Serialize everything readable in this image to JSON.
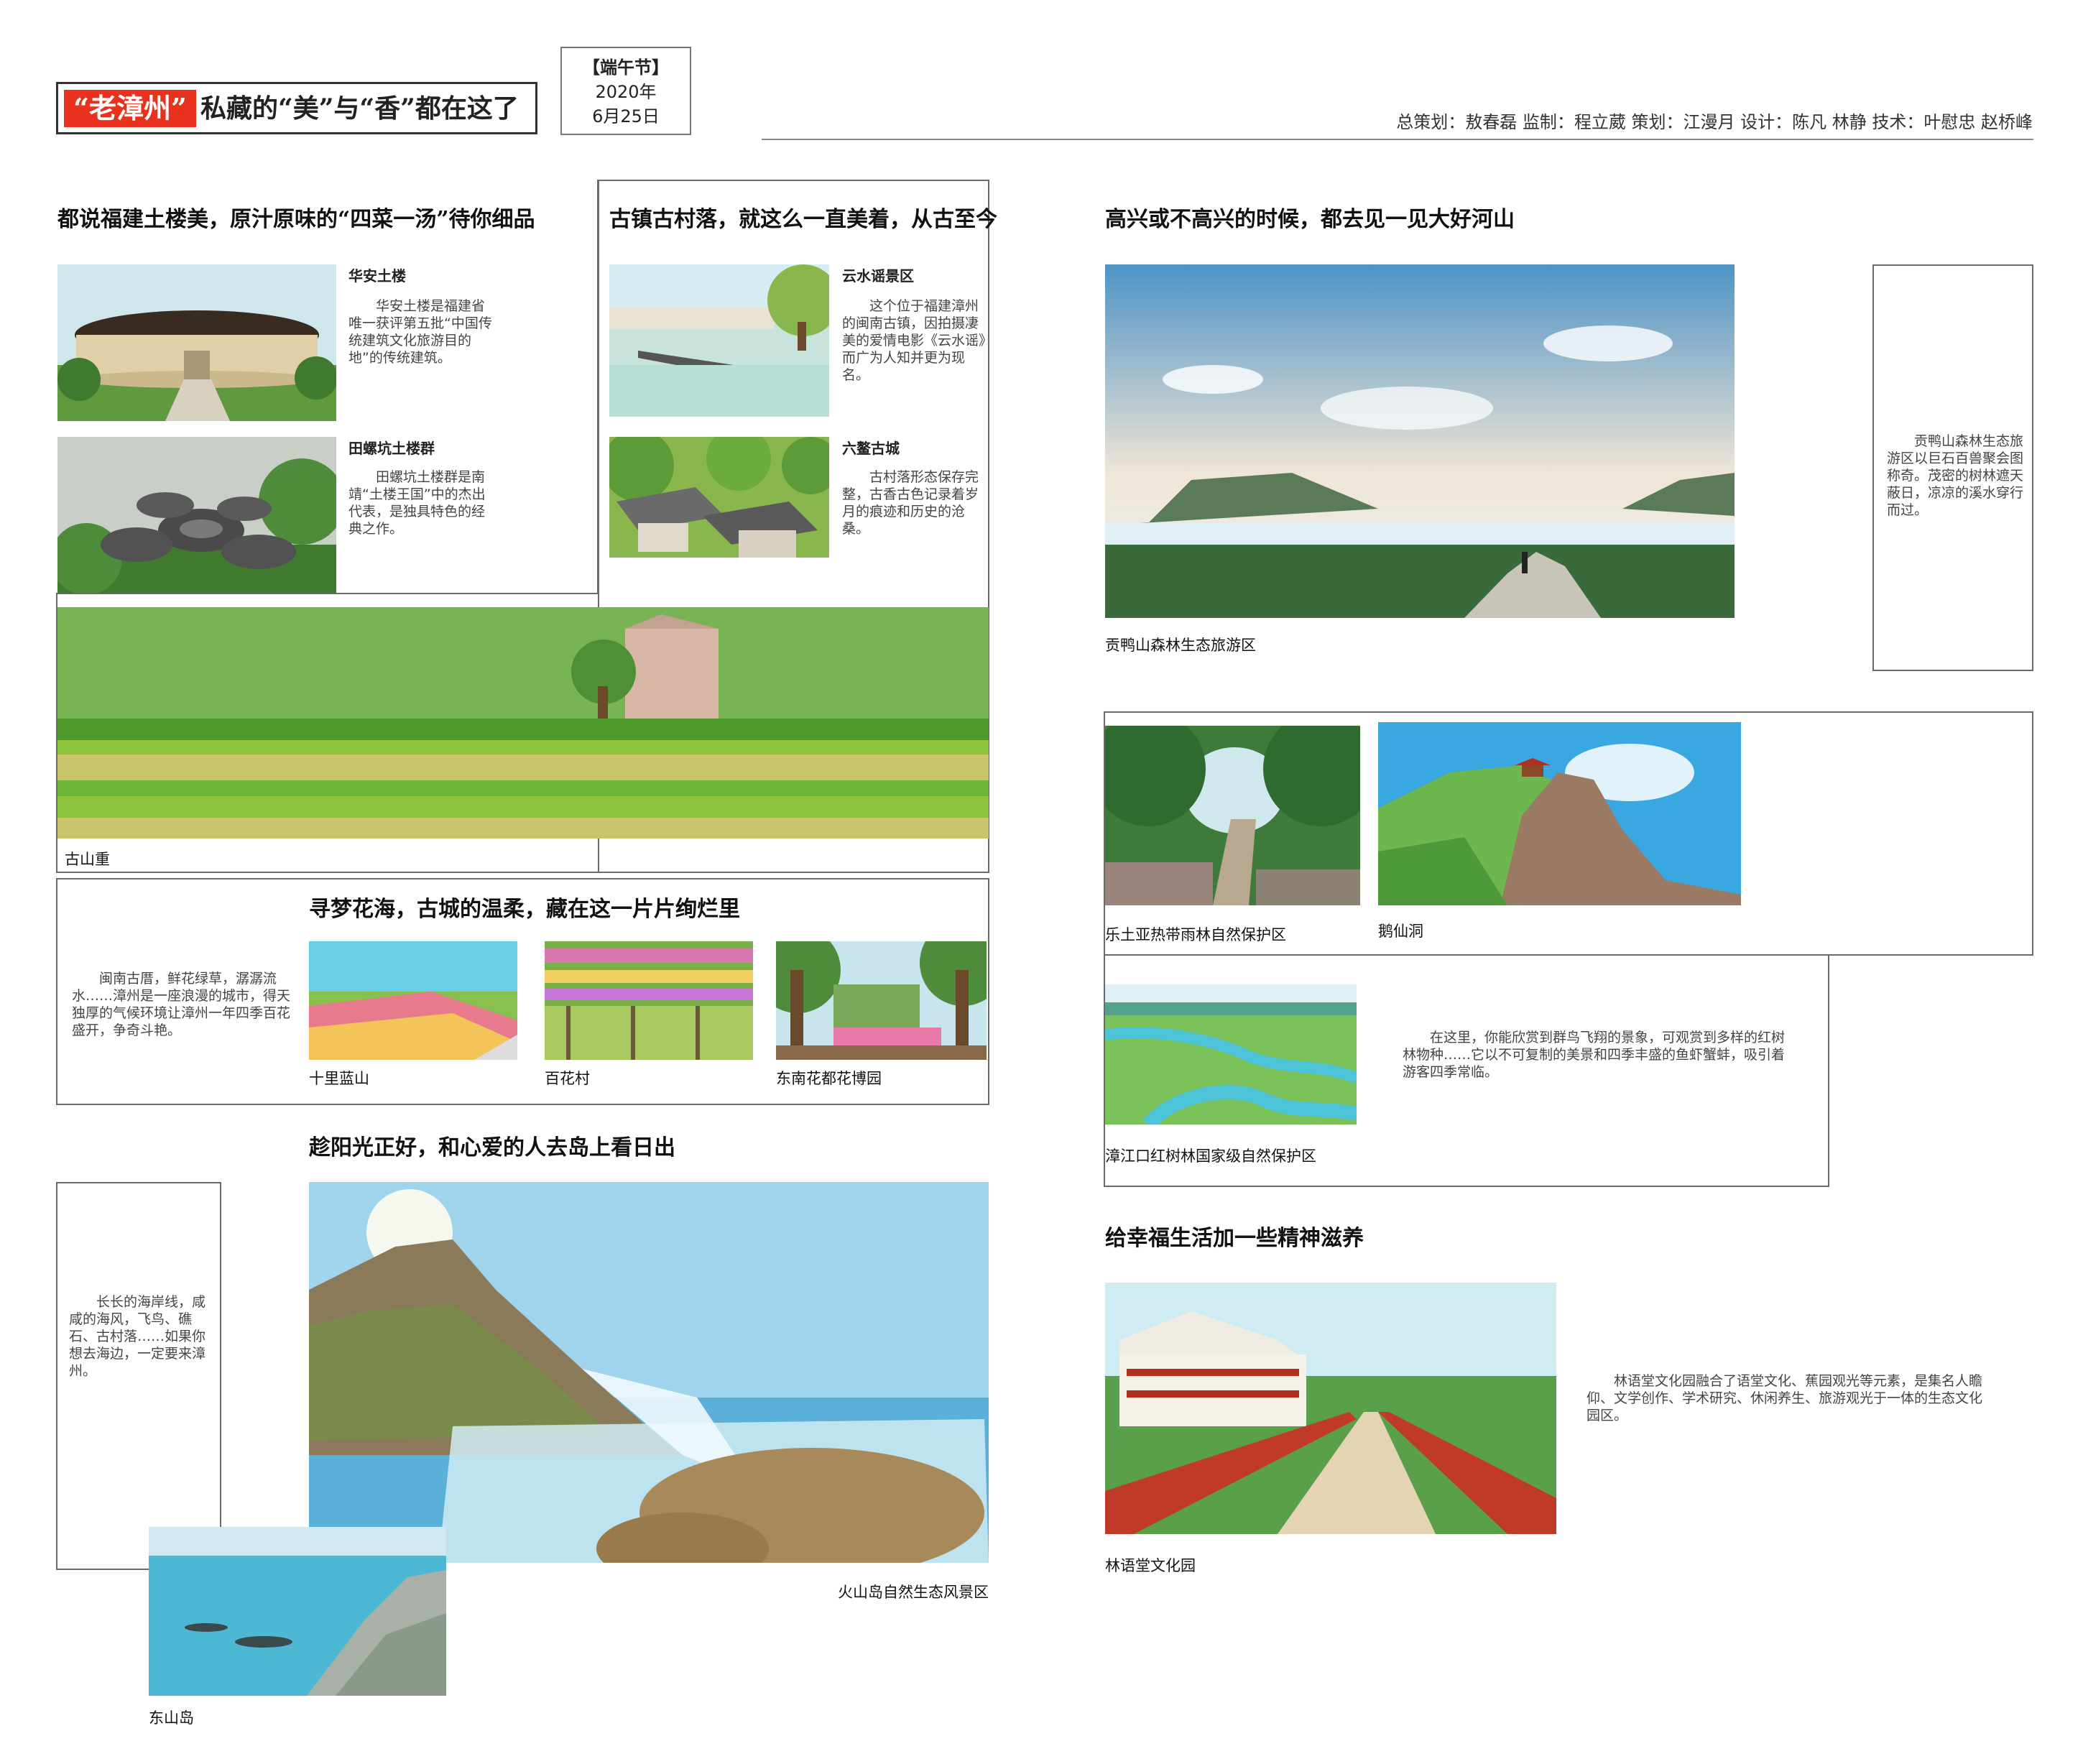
{
  "header": {
    "title_highlight": "“老漳州”",
    "title_rest": "私藏的“美”与“香”都在这了",
    "festival": "【端午节】",
    "year": "2020年",
    "date": "6月25日",
    "credits": "总策划：敖春磊   监制：程立葳   策划：江漫月   设计：陈凡 林静   技术：叶慰忠 赵桥峰"
  },
  "sections": {
    "tulou": {
      "heading": "都说福建土楼美，原汁原味的“四菜一汤”待你细品",
      "items": [
        {
          "name": "华安土楼",
          "desc": "华安土楼是福建省唯一获评第五批“中国传统建筑文化旅游目的地”的传统建筑。"
        },
        {
          "name": "田螺坑土楼群",
          "desc": "田螺坑土楼群是南靖“土楼王国”中的杰出代表，是独具特色的经典之作。"
        }
      ]
    },
    "ancient_town": {
      "heading": "古镇古村落，就这么一直美着，从古至今",
      "items": [
        {
          "name": "云水谣景区",
          "desc": "这个位于福建漳州的闽南古镇，因拍摄凄美的爱情电影《云水谣》而广为人知并更为现名。"
        },
        {
          "name": "六鳌古城",
          "desc": "古村落形态保存完整，古香古色记录着岁月的痕迹和历史的沧桑。"
        }
      ]
    },
    "gushanzhong": {
      "caption": "古山重"
    },
    "flowers": {
      "heading": "寻梦花海，古城的温柔，藏在这一片片绚烂里",
      "desc": "闽南古厝，鲜花绿草，潺潺流水……漳州是一座浪漫的城市，得天独厚的气候环境让漳州一年四季百花盛开，争奇斗艳。",
      "items": [
        "十里蓝山",
        "百花村",
        "东南花都花博园"
      ]
    },
    "island": {
      "heading": "趁阳光正好，和心爱的人去岛上看日出",
      "desc": "长长的海岸线，咸咸的海风，飞鸟、礁石、古村落……如果你想去海边，一定要来漳州。",
      "main_caption": "火山岛自然生态风景区",
      "small_caption": "东山岛"
    },
    "mountain": {
      "heading": "高兴或不高兴的时候，都去见一见大好河山",
      "caption": "贡鸭山森林生态旅游区",
      "desc": "贡鸭山森林生态旅游区以巨石百兽聚会图称奇。茂密的树林遮天蔽日，凉凉的溪水穿行而过。"
    },
    "forest": {
      "items": [
        "乐土亚热带雨林自然保护区",
        "鹅仙洞"
      ]
    },
    "mangrove": {
      "caption": "漳江口红树林国家级自然保护区",
      "desc": "在这里，你能欣赏到群鸟飞翔的景象，可观赏到多样的红树林物种……它以不可复制的美景和四季丰盛的鱼虾蟹蚌，吸引着游客四季常临。"
    },
    "culture": {
      "heading": "给幸福生活加一些精神滋养",
      "caption": "林语堂文化园",
      "desc": "林语堂文化园融合了语堂文化、蕉园观光等元素，是集名人瞻仰、文学创作、学术研究、休闲养生、旅游观光于一体的生态文化园区。"
    }
  }
}
